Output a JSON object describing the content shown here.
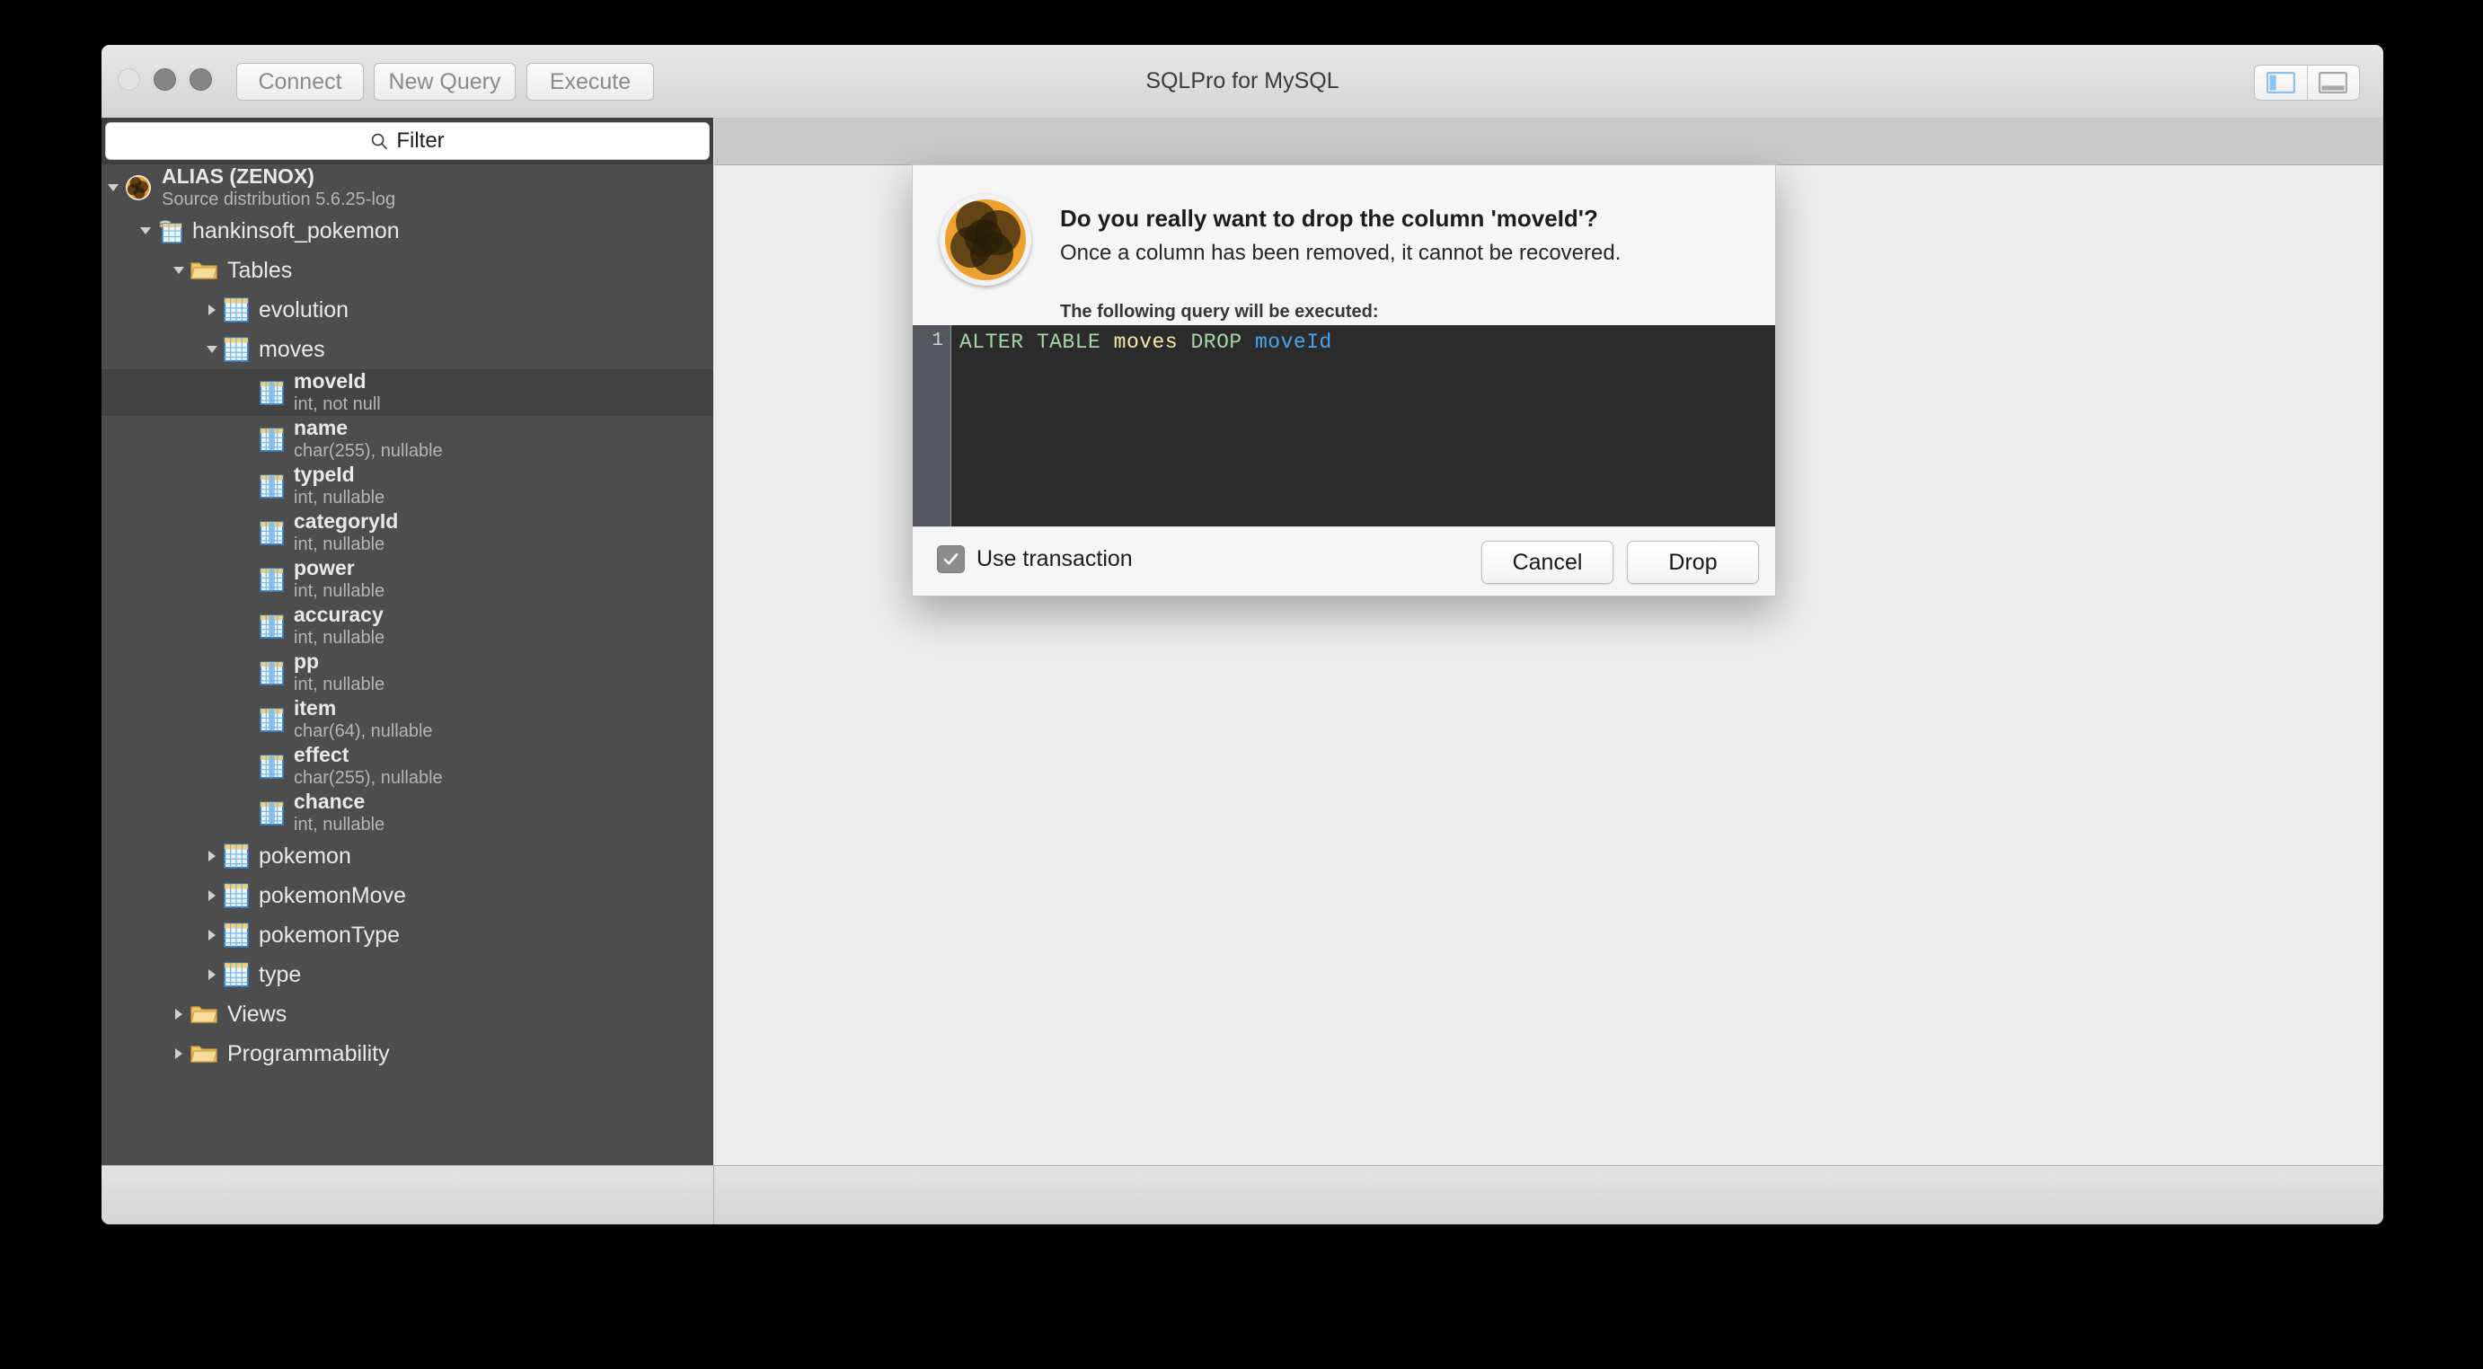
{
  "window": {
    "title": "SQLPro for MySQL",
    "traffic_lights": [
      "close-button",
      "minimize-button",
      "zoom-button"
    ],
    "toolbar": {
      "connect_label": "Connect",
      "new_query_label": "New Query",
      "execute_label": "Execute"
    },
    "view_toggle": {
      "sidebar_icon": "sidebar-panel-icon",
      "bottom_panel_icon": "bottom-panel-icon",
      "sidebar_active_color": "#8cc2ee",
      "bottom_inactive_color": "#a9a9a9"
    }
  },
  "sidebar": {
    "filter": {
      "placeholder": "Filter",
      "value": "",
      "icon": "search-icon"
    },
    "tree": [
      {
        "id": "connection",
        "label": "ALIAS (ZENOX)",
        "sub": "Source distribution 5.6.25-log",
        "icon": "app-logo-icon",
        "depth": 0,
        "twisty": "down",
        "selected": false,
        "bold": true
      },
      {
        "id": "database",
        "label": "hankinsoft_pokemon",
        "sub": "",
        "icon": "database-icon",
        "depth": 1,
        "twisty": "down",
        "selected": false,
        "bold": false
      },
      {
        "id": "tables-folder",
        "label": "Tables",
        "sub": "",
        "icon": "folder-icon",
        "depth": 2,
        "twisty": "down",
        "selected": false,
        "bold": false
      },
      {
        "id": "table-evolution",
        "label": "evolution",
        "sub": "",
        "icon": "table-icon",
        "depth": 3,
        "twisty": "right",
        "selected": false,
        "bold": false
      },
      {
        "id": "table-moves",
        "label": "moves",
        "sub": "",
        "icon": "table-icon",
        "depth": 3,
        "twisty": "down",
        "selected": false,
        "bold": false
      },
      {
        "id": "column-moveId",
        "label": "moveId",
        "sub": "int, not null",
        "icon": "column-icon",
        "depth": 4,
        "twisty": "none",
        "selected": true,
        "bold": true
      },
      {
        "id": "column-name",
        "label": "name",
        "sub": "char(255), nullable",
        "icon": "column-icon",
        "depth": 4,
        "twisty": "none",
        "selected": false,
        "bold": true
      },
      {
        "id": "column-typeId",
        "label": "typeId",
        "sub": "int, nullable",
        "icon": "column-icon",
        "depth": 4,
        "twisty": "none",
        "selected": false,
        "bold": true
      },
      {
        "id": "column-categoryId",
        "label": "categoryId",
        "sub": "int, nullable",
        "icon": "column-icon",
        "depth": 4,
        "twisty": "none",
        "selected": false,
        "bold": true
      },
      {
        "id": "column-power",
        "label": "power",
        "sub": "int, nullable",
        "icon": "column-icon",
        "depth": 4,
        "twisty": "none",
        "selected": false,
        "bold": true
      },
      {
        "id": "column-accuracy",
        "label": "accuracy",
        "sub": "int, nullable",
        "icon": "column-icon",
        "depth": 4,
        "twisty": "none",
        "selected": false,
        "bold": true
      },
      {
        "id": "column-pp",
        "label": "pp",
        "sub": "int, nullable",
        "icon": "column-icon",
        "depth": 4,
        "twisty": "none",
        "selected": false,
        "bold": true
      },
      {
        "id": "column-item",
        "label": "item",
        "sub": "char(64), nullable",
        "icon": "column-icon",
        "depth": 4,
        "twisty": "none",
        "selected": false,
        "bold": true
      },
      {
        "id": "column-effect",
        "label": "effect",
        "sub": "char(255), nullable",
        "icon": "column-icon",
        "depth": 4,
        "twisty": "none",
        "selected": false,
        "bold": true
      },
      {
        "id": "column-chance",
        "label": "chance",
        "sub": "int, nullable",
        "icon": "column-icon",
        "depth": 4,
        "twisty": "none",
        "selected": false,
        "bold": true
      },
      {
        "id": "table-pokemon",
        "label": "pokemon",
        "sub": "",
        "icon": "table-icon",
        "depth": 3,
        "twisty": "right",
        "selected": false,
        "bold": false
      },
      {
        "id": "table-pokemonMove",
        "label": "pokemonMove",
        "sub": "",
        "icon": "table-icon",
        "depth": 3,
        "twisty": "right",
        "selected": false,
        "bold": false
      },
      {
        "id": "table-pokemonType",
        "label": "pokemonType",
        "sub": "",
        "icon": "table-icon",
        "depth": 3,
        "twisty": "right",
        "selected": false,
        "bold": false
      },
      {
        "id": "table-type",
        "label": "type",
        "sub": "",
        "icon": "table-icon",
        "depth": 3,
        "twisty": "right",
        "selected": false,
        "bold": false
      },
      {
        "id": "views-folder",
        "label": "Views",
        "sub": "",
        "icon": "folder-icon",
        "depth": 2,
        "twisty": "right",
        "selected": false,
        "bold": false
      },
      {
        "id": "programmability-folder",
        "label": "Programmability",
        "sub": "",
        "icon": "folder-icon",
        "depth": 2,
        "twisty": "right",
        "selected": false,
        "bold": false
      }
    ]
  },
  "dialog": {
    "icon": "app-logo-icon",
    "heading": "Do you really want to drop the column 'moveId'?",
    "subtext": "Once a column has been removed, it cannot be recovered.",
    "query_note": "The following query will be executed:",
    "query": {
      "line_number": "1",
      "tokens": [
        {
          "text": "ALTER TABLE ",
          "kind": "keyword"
        },
        {
          "text": "moves ",
          "kind": "table"
        },
        {
          "text": "DROP ",
          "kind": "keyword"
        },
        {
          "text": "moveId",
          "kind": "column"
        }
      ],
      "full_text": "ALTER TABLE moves DROP moveId",
      "colors": {
        "keyword": "#a5d6a7",
        "table": "#f5e7a5",
        "column": "#4aa3f0",
        "background": "#2b2b2b",
        "gutter": "#53555f"
      }
    },
    "use_transaction": {
      "label": "Use transaction",
      "checked": true
    },
    "cancel_label": "Cancel",
    "drop_label": "Drop"
  },
  "colors": {
    "sidebar_bg": "#4d4d4d",
    "sidebar_selected": "#434343",
    "content_bg": "#ececec",
    "accent_orange": "#efa12f"
  }
}
